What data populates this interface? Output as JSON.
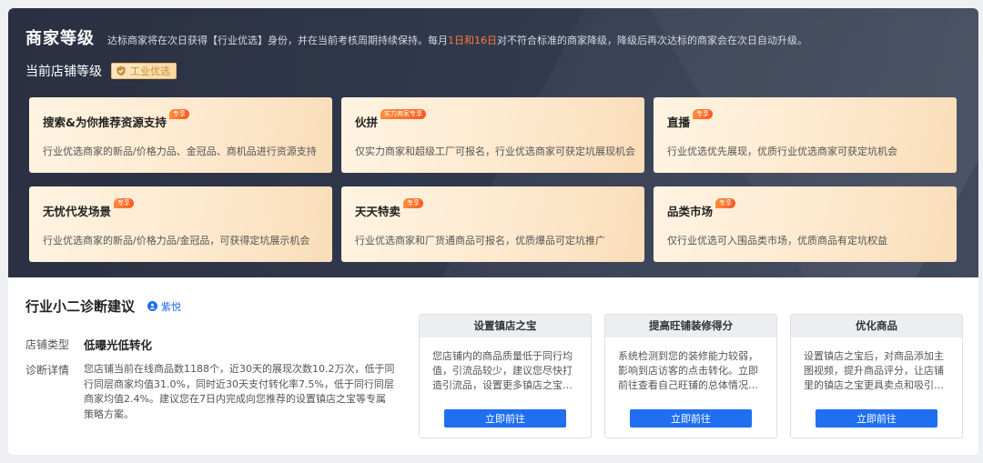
{
  "header": {
    "title": "商家等级",
    "desc_prefix": "达标商家将在次日获得【行业优选】身份，并在当前考核周期持续保持。每月",
    "desc_highlight": "1日和16日",
    "desc_suffix": "对不符合标准的商家降级，降级后再次达标的商家会在次日自动升级。"
  },
  "current_level": {
    "label": "当前店铺等级",
    "badge": "工业优选",
    "badge_icon": "shield-check-icon"
  },
  "colors": {
    "accent_blue": "#1f6ff0",
    "highlight_orange": "#ff7a3d",
    "tag_orange": "#ff6a26",
    "badge_gold": "#c99139"
  },
  "cards": [
    {
      "title": "搜索&为你推荐资源支持",
      "tag": "专享",
      "desc": "行业优选商家的新品/价格力品、金冠品、商机品进行资源支持"
    },
    {
      "title": "伙拼",
      "tag": "实力商家专享",
      "desc": "仅实力商家和超级工厂可报名，行业优选商家可获定坑展现机会"
    },
    {
      "title": "直播",
      "tag": "专享",
      "desc": "行业优选优先展现，优质行业优选商家可获定坑机会"
    },
    {
      "title": "无忧代发场景",
      "tag": "专享",
      "desc": "行业优选商家的新品/价格力品/金冠品，可获得定坑展示机会"
    },
    {
      "title": "天天特卖",
      "tag": "专享",
      "desc": "行业优选商家和厂货通商品可报名，优质爆品可定坑推广"
    },
    {
      "title": "品类市场",
      "tag": "专享",
      "desc": "仅行业优选可入围品类市场，优质商品有定坑权益"
    }
  ],
  "diagnosis": {
    "title": "行业小二诊断建议",
    "advisor_name": "紫悦",
    "shop_type_label": "店铺类型",
    "shop_type_value": "低曝光低转化",
    "detail_label": "诊断详情",
    "detail_text": "您店铺当前在线商品数1188个，近30天的展现次数10.2万次，低于同行同层商家均值31.0%，同时近30天支付转化率7.5%，低于同行同层商家均值2.4%。建议您在7日内完成向您推荐的设置镇店之宝等专属策略方案。"
  },
  "suggestions": [
    {
      "title": "设置镇店之宝",
      "body": "您店铺内的商品质量低于同行均值，引流品较少，建议您尽快打造引流品，设置更多镇店之宝，商...",
      "button": "立即前往"
    },
    {
      "title": "提高旺铺装修得分",
      "body": "系统检测到您的装修能力较弱，影响到店访客的点击转化。立即前往查看自己旺铺的总体情况，并根...",
      "button": "立即前往"
    },
    {
      "title": "优化商品",
      "body": "设置镇店之宝后，对商品添加主图视频，提升商品评分，让店铺里的镇店之宝更具卖点和吸引力，快...",
      "button": "立即前往"
    }
  ]
}
